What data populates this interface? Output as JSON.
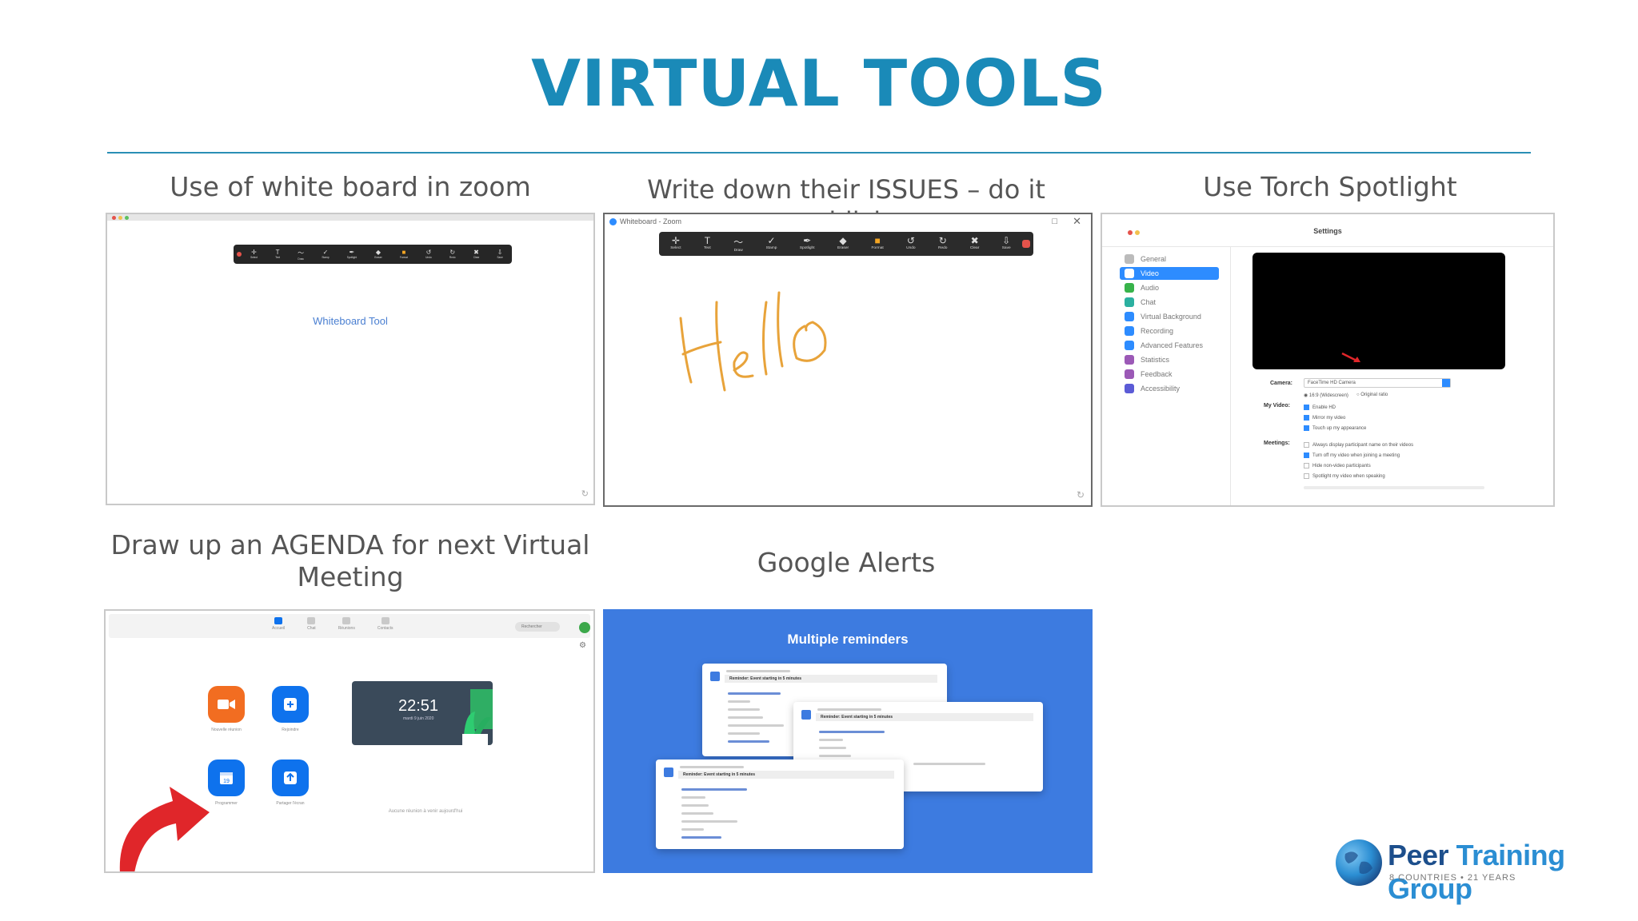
{
  "slide": {
    "title": "VIRTUAL TOOLS",
    "captions": {
      "whiteboard": "Use of white board in zoom",
      "issues": "Write down their ISSUES – do it publicly",
      "spotlight": "Use Torch Spotlight",
      "agenda_line1": "Draw up an AGENDA for next Virtual",
      "agenda_line2": "Meeting",
      "alerts": "Google Alerts"
    }
  },
  "whiteboard_shot": {
    "center_text": "Whiteboard Tool",
    "toolbar_labels": [
      "Select",
      "Text",
      "Draw",
      "Stamp",
      "Spotlight",
      "Eraser",
      "Format",
      "Undo",
      "Redo",
      "Clear",
      "Save"
    ]
  },
  "issues_shot": {
    "window_title": "Whiteboard - Zoom",
    "toolbar_labels": [
      "Select",
      "Text",
      "Draw",
      "Stamp",
      "Spotlight",
      "Eraser",
      "Format",
      "Undo",
      "Redo",
      "Clear",
      "Save"
    ],
    "handwriting": "Hello",
    "ink_color": "#e8a33a"
  },
  "settings_shot": {
    "heading": "Settings",
    "nav": [
      "General",
      "Video",
      "Audio",
      "Chat",
      "Virtual Background",
      "Recording",
      "Advanced Features",
      "Statistics",
      "Feedback",
      "Accessibility"
    ],
    "nav_colors": [
      "#bbbbbb",
      "#2d8cff",
      "#38b34a",
      "#2bb0a0",
      "#2d8cff",
      "#2d8cff",
      "#2d8cff",
      "#9b59b6",
      "#9b59b6",
      "#5b5bd6"
    ],
    "camera_label": "Camera:",
    "camera_value": "FaceTime HD Camera",
    "aspect_options": [
      "16:9 (Widescreen)",
      "Original ratio"
    ],
    "my_video_label": "My Video:",
    "my_video_options": [
      "Enable HD",
      "Mirror my video",
      "Touch up my appearance"
    ],
    "meetings_label": "Meetings:",
    "meetings_options": [
      "Always display participant name on their videos",
      "Turn off my video when joining a meeting",
      "Hide non-video participants",
      "Spotlight my video when speaking"
    ],
    "accent": "#2d8cff"
  },
  "agenda_shot": {
    "nav_tabs": [
      "Accueil",
      "Chat",
      "Réunions",
      "Contacts"
    ],
    "search_placeholder": "Rechercher",
    "clock_time": "22:51",
    "clock_date": "mardi 9 juin 2020",
    "tiles": [
      "Nouvelle réunion",
      "Rejoindre",
      "Programmer",
      "Partager l'écran"
    ],
    "empty_text": "Aucune réunion à venir aujourd'hui",
    "orange": "#f26d21",
    "blue": "#0e72ed",
    "arrow_color": "#e0262a"
  },
  "alerts_shot": {
    "heading": "Multiple reminders",
    "background": "#3d7be0",
    "card_titles": [
      "Reminder: Event starting in 5 minutes",
      "Reminder: Event starting in 5 minutes",
      "Reminder: Event starting in 5 minutes"
    ]
  },
  "logo": {
    "name_part1": "Peer",
    "name_part2": "Training",
    "name_part3": "Group",
    "tagline": "8 COUNTRIES • 21 YEARS",
    "color_dark": "#1d4f8c",
    "color_light": "#2b8ed3"
  }
}
